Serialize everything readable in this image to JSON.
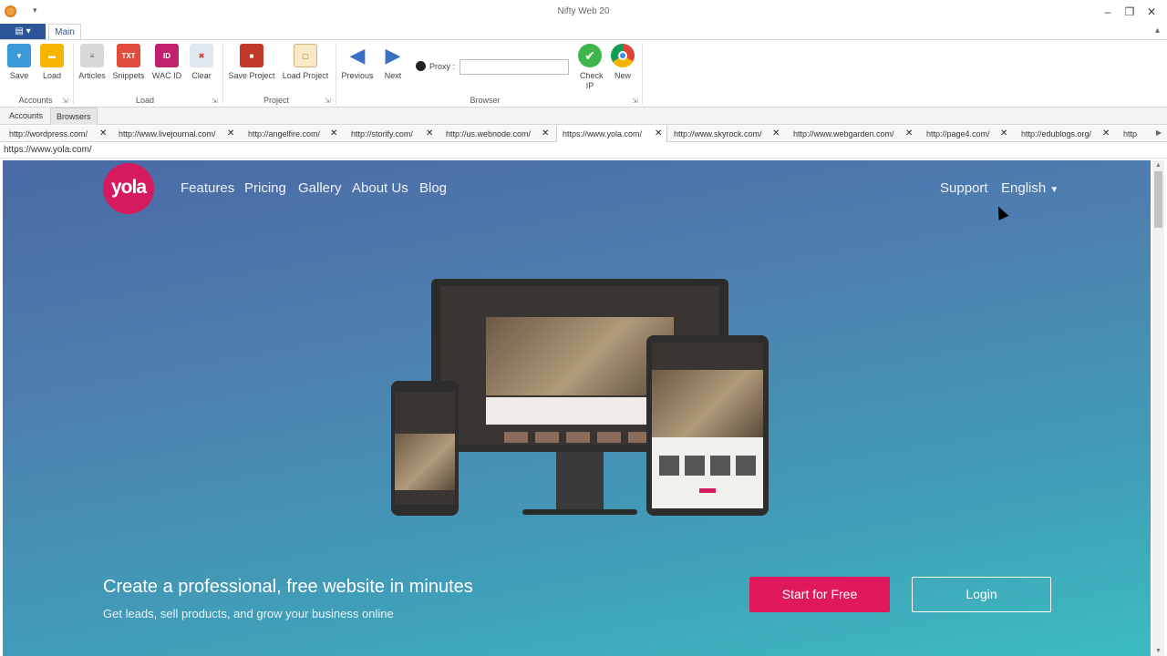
{
  "window": {
    "title": "Nifty Web 20",
    "minimize": "–",
    "restore": "❐",
    "close": "✕"
  },
  "ribbon": {
    "file_menu": "▤ ▾",
    "tab_main": "Main",
    "collapse": "▴",
    "buttons": {
      "save": "Save",
      "load": "Load",
      "articles": "Articles",
      "snippets": "Snippets",
      "wac_id": "WAC ID",
      "clear": "Clear",
      "save_project": "Save Project",
      "load_project": "Load Project",
      "previous": "Previous",
      "next": "Next",
      "check_ip": "Check IP",
      "new": "New"
    },
    "proxy_label": "Proxy :",
    "proxy_value": "",
    "groups": {
      "accounts": "Accounts",
      "load": "Load",
      "project": "Project",
      "browser": "Browser"
    },
    "icon_labels": {
      "snippets": "TXT",
      "wac_id": "ID"
    }
  },
  "panel_tabs": [
    "Accounts",
    "Browsers"
  ],
  "browser_tabs": [
    "http://wordpress.com/",
    "http://www.livejournal.com/",
    "http://angelfire.com/",
    "http://storify.com/",
    "http://us.webnode.com/",
    "https://www.yola.com/",
    "http://www.skyrock.com/",
    "http://www.webgarden.com/",
    "http://page4.com/",
    "http://edublogs.org/",
    "http"
  ],
  "tab_close_glyph": "✕",
  "address": "https://www.yola.com/",
  "web": {
    "logo": "yola",
    "nav": [
      "Features",
      "Pricing",
      "Gallery",
      "About Us",
      "Blog"
    ],
    "support": "Support",
    "language": "English",
    "headline": "Create a professional, free website in minutes",
    "subhead": "Get leads, sell products, and grow your business online",
    "cta_start": "Start for Free",
    "cta_login": "Login"
  },
  "colors": {
    "yola_pink": "#d51a5f",
    "ribbon_blue": "#2b579a",
    "gradient_top": "#4a6aa5",
    "gradient_bottom": "#3cbcc2"
  }
}
